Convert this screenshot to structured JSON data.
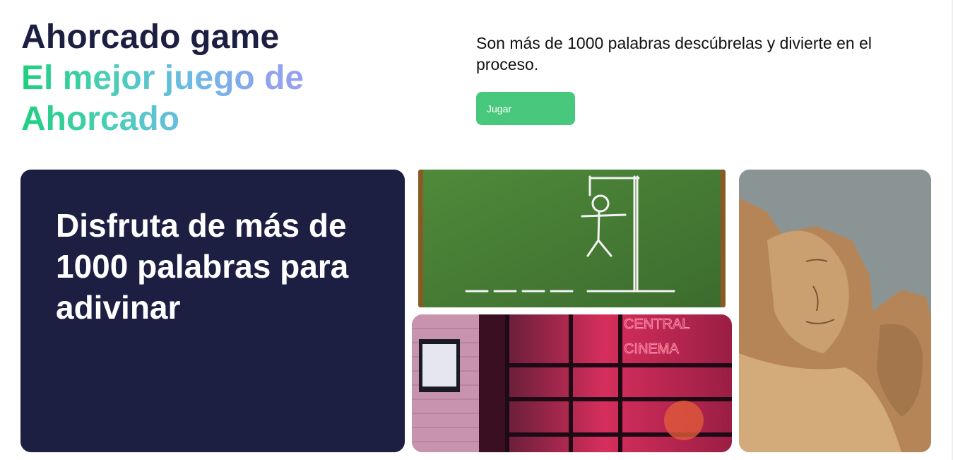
{
  "hero": {
    "title": "Ahorcado game",
    "subtitle": "El mejor juego de Ahorcado",
    "tagline": "Son más de 1000 palabras descúbrelas y divierte en el proceso.",
    "play_label": "Jugar"
  },
  "feature_card": {
    "heading": "Disfruta de más de 1000 palabras para adivinar"
  },
  "gallery": {
    "cinema_sign": "CENTRAL CINEMA"
  },
  "colors": {
    "navy": "#1d1f42",
    "accent_green": "#48c87d",
    "gradient": [
      "#1ecf7d",
      "#6db9e6",
      "#9b9ff0"
    ]
  }
}
